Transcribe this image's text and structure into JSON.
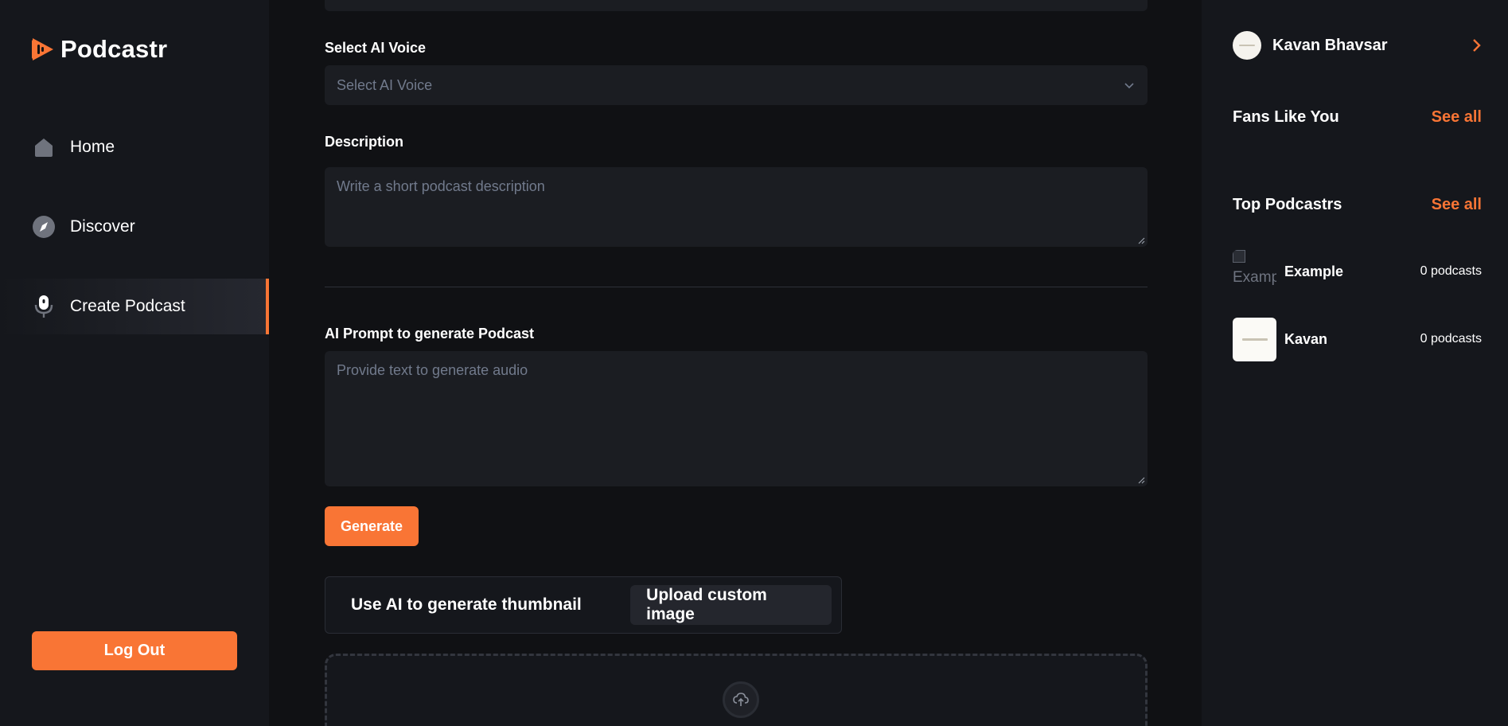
{
  "sidebar": {
    "brand": "Podcastr",
    "nav": [
      {
        "label": "Home",
        "icon": "home-icon",
        "active": false
      },
      {
        "label": "Discover",
        "icon": "compass-icon",
        "active": false
      },
      {
        "label": "Create Podcast",
        "icon": "microphone-icon",
        "active": true
      }
    ],
    "logout_label": "Log Out"
  },
  "form": {
    "voice_label": "Select AI Voice",
    "voice_placeholder": "Select AI Voice",
    "description_label": "Description",
    "description_placeholder": "Write a short podcast description",
    "prompt_label": "AI Prompt to generate Podcast",
    "prompt_placeholder": "Provide text to generate audio",
    "generate_label": "Generate",
    "thumbnail_toggle": {
      "ai_label": "Use AI to generate thumbnail",
      "upload_label": "Upload custom image",
      "selected": "upload"
    }
  },
  "right_sidebar": {
    "user_name": "Kavan Bhavsar",
    "fans_title": "Fans Like You",
    "fans_see_all": "See all",
    "top_title": "Top Podcastrs",
    "top_see_all": "See all",
    "top_podcasters": [
      {
        "name": "Example",
        "count": "0 podcasts",
        "image_alt": "Example"
      },
      {
        "name": "Kavan",
        "count": "0 podcasts"
      }
    ]
  },
  "colors": {
    "accent": "#f97535",
    "background": "#101114",
    "panel": "#15171c",
    "input": "#1b1d22"
  }
}
